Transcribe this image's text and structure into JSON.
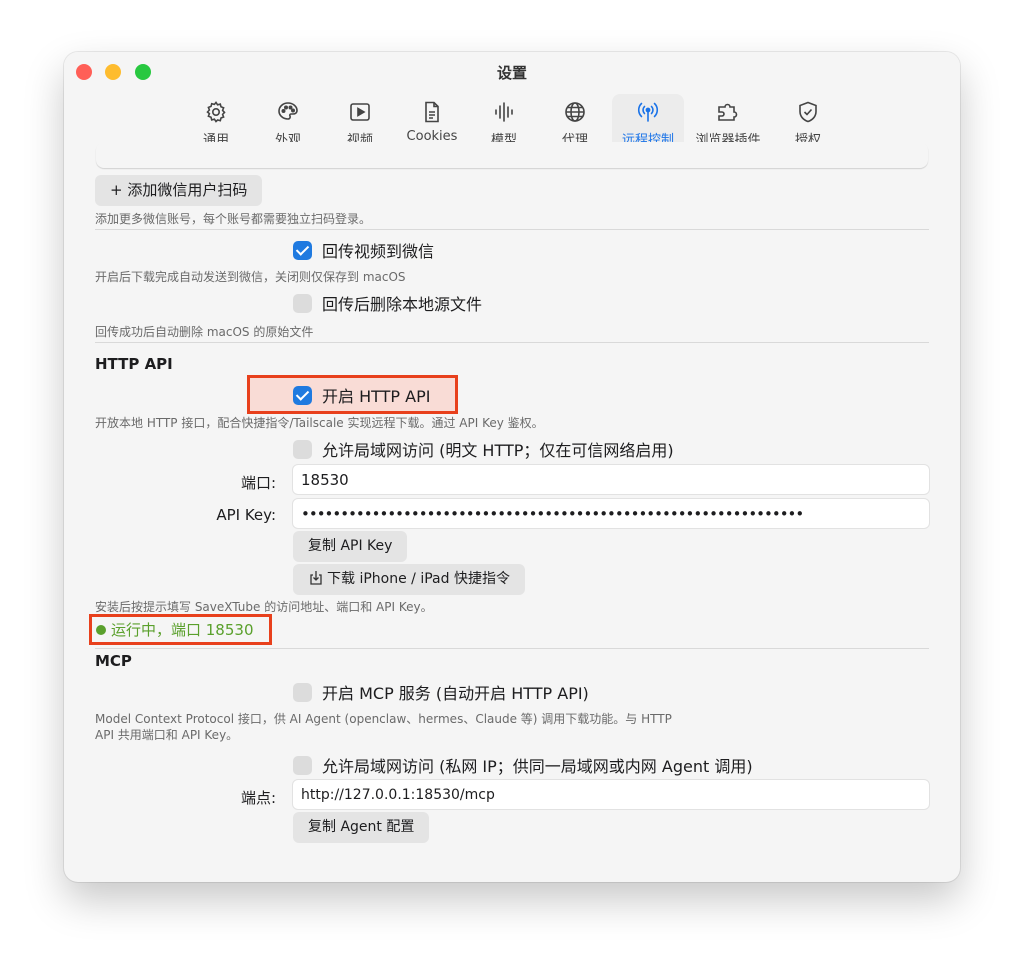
{
  "window": {
    "title": "设置"
  },
  "toolbar": {
    "items": [
      {
        "label": "通用",
        "icon": "gear-icon"
      },
      {
        "label": "外观",
        "icon": "palette-icon"
      },
      {
        "label": "视频",
        "icon": "play-icon"
      },
      {
        "label": "Cookies",
        "icon": "document-icon"
      },
      {
        "label": "模型",
        "icon": "waveform-icon"
      },
      {
        "label": "代理",
        "icon": "globe-icon"
      },
      {
        "label": "远程控制",
        "icon": "antenna-icon"
      },
      {
        "label": "浏览器插件",
        "icon": "puzzle-icon"
      },
      {
        "label": "授权",
        "icon": "shield-check-icon"
      }
    ],
    "active_index": 6
  },
  "wechat": {
    "add_user_button": "+ 添加微信用户扫码",
    "add_user_hint": "添加更多微信账号，每个账号都需要独立扫码登录。",
    "send_back_label": "回传视频到微信",
    "send_back_checked": true,
    "send_back_hint": "开启后下载完成自动发送到微信，关闭则仅保存到 macOS",
    "delete_after_label": "回传后删除本地源文件",
    "delete_after_checked": false,
    "delete_after_hint": "回传成功后自动删除 macOS 的原始文件"
  },
  "http_api": {
    "heading": "HTTP API",
    "enable_label": "开启 HTTP API",
    "enable_checked": true,
    "enable_hint": "开放本地 HTTP 接口，配合快捷指令/Tailscale 实现远程下载。通过 API Key 鉴权。",
    "lan_label": "允许局域网访问 (明文 HTTP；仅在可信网络启用)",
    "lan_checked": false,
    "port_label": "端口:",
    "port_value": "18530",
    "apikey_label": "API Key:",
    "apikey_value": "••••••••••••••••••••••••••••••••••••••••••••••••••••••••••••••••",
    "copy_key_button": "复制 API Key",
    "download_shortcut_button": "下载 iPhone / iPad 快捷指令",
    "install_hint": "安装后按提示填写 SaveXTube 的访问地址、端口和 API Key。",
    "status_text": "运行中，端口 18530",
    "status_color": "#5aa02c"
  },
  "mcp": {
    "heading": "MCP",
    "enable_label": "开启 MCP 服务 (自动开启 HTTP API)",
    "enable_checked": false,
    "hint_line1": "Model Context Protocol 接口，供 AI Agent (openclaw、hermes、Claude 等) 调用下载功能。与 HTTP",
    "hint_line2": "API 共用端口和 API Key。",
    "lan_label": "允许局域网访问 (私网 IP；供同一局域网或内网 Agent 调用)",
    "lan_checked": false,
    "endpoint_label": "端点:",
    "endpoint_value": "http://127.0.0.1:18530/mcp",
    "copy_config_button": "复制 Agent 配置"
  },
  "colors": {
    "accent": "#1f7ae0",
    "highlight_border": "#e8401c"
  }
}
